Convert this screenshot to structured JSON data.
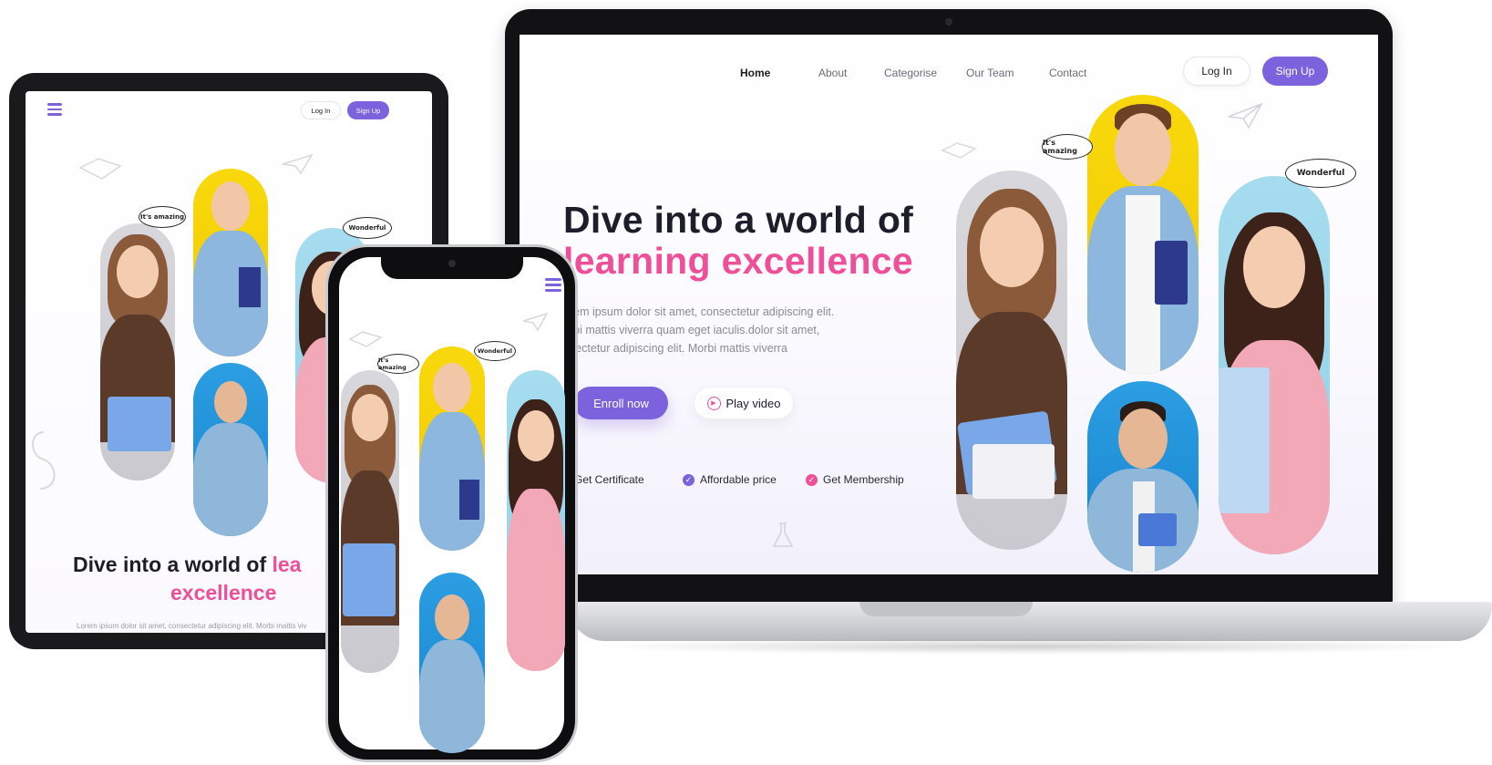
{
  "colors": {
    "accent": "#7c62dd",
    "pink": "#ee4f98",
    "dark": "#1e1d2a",
    "muted": "#8a8a97"
  },
  "laptop": {
    "nav": {
      "home": "Home",
      "about": "About",
      "categorise": "Categorise",
      "our_team": "Our Team",
      "contact": "Contact"
    },
    "login": "Log In",
    "signup": "Sign Up",
    "hero_line1": "Dive into a world of",
    "hero_line2": "learning excellence",
    "paragraph": [
      "orem ipsum dolor sit amet, consectetur adipiscing elit.",
      "orbi mattis viverra quam eget iaculis.dolor sit amet,",
      "nsectetur adipiscing elit. Morbi mattis viverra"
    ],
    "enroll": "Enroll now",
    "play": "Play video",
    "features": {
      "certificate": "Get Certificate",
      "price": "Affordable price",
      "membership": "Get Membership"
    },
    "bubbles": {
      "amazing": "It's amazing",
      "wonderful": "Wonderful"
    }
  },
  "tablet": {
    "login": "Log In",
    "signup": "Sign Up",
    "title_dark": "Dive into a world of ",
    "title_pink_part": "lea",
    "title_line2": "excellence",
    "paragraph": "Lorem ipsum dolor sit amet, consectetur adipiscing elit. Morbi mattis viv",
    "bubbles": {
      "amazing": "It's amazing",
      "wonderful": "Wonderful"
    }
  },
  "phone": {
    "bubbles": {
      "amazing": "It's amazing",
      "wonderful": "Wonderful"
    }
  },
  "icons": [
    "hamburger-menu-icon",
    "play-circle-icon",
    "check-circle-icon",
    "paper-plane-icon"
  ]
}
